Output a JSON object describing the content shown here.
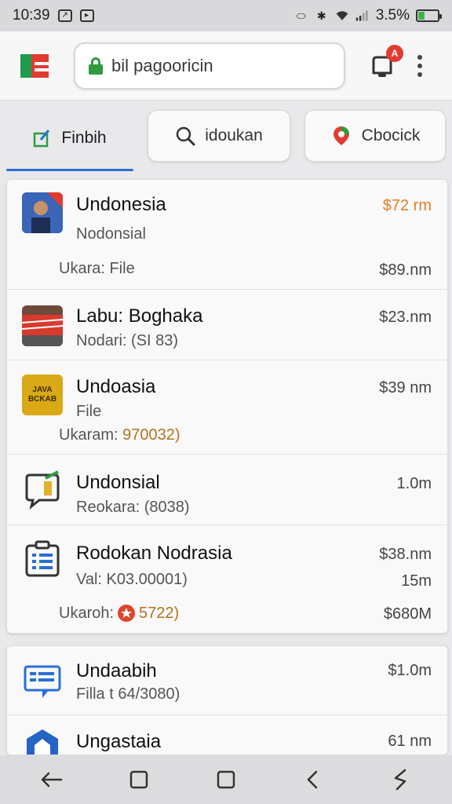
{
  "status_bar": {
    "time": "10:39",
    "battery_text": "3.5%",
    "battery_level": 0.35
  },
  "app_bar": {
    "url": "bil pagooricin",
    "notification_badge": "A"
  },
  "tabs": {
    "active_label": "Finbih",
    "search_label": "idoukan",
    "third_label": "Cbocick"
  },
  "list1": [
    {
      "title": "Undonesia",
      "subtitle": "Nodonsial",
      "amount": "$72 rm",
      "extra_label": "Ukara: File",
      "extra_amount": "$89.nm",
      "icon": "profile-photo-icon"
    },
    {
      "title": "Labu: Boghaka",
      "subtitle": "Nodari: (SI 83)",
      "amount": "$23.nm",
      "icon": "banner-photo-icon"
    },
    {
      "title": "Undoasia",
      "subtitle": "File",
      "amount": "$39 nm",
      "extra_prefix": "Ukaram: ",
      "extra_value": "970032)",
      "icon": "java-logo-icon",
      "icon_text": "JAVA BCKAB"
    },
    {
      "title": "Undonsial",
      "subtitle": "Reokara: (8038)",
      "amount": "1.0m",
      "icon": "chat-bubble-icon"
    },
    {
      "title": "Rodokan Nodrasia",
      "subtitle": "Val: K03.00001)",
      "amount": "$38.nm",
      "amount2": "15m",
      "extra_prefix": "Ukaroh: ",
      "extra_value": "5722)",
      "extra_amount": "$680M",
      "icon": "clipboard-list-icon"
    }
  ],
  "list2": [
    {
      "title": "Undaabih",
      "subtitle": "Filla t 64/3080)",
      "amount": "$1.0m",
      "icon": "message-screen-icon"
    },
    {
      "title": "Ungastaia",
      "amount": "61 nm",
      "icon": "shield-home-icon"
    }
  ],
  "colors": {
    "accent": "#2a6fd6",
    "green": "#2e9b3f",
    "red": "#e23b30",
    "orange": "#e67e22"
  }
}
